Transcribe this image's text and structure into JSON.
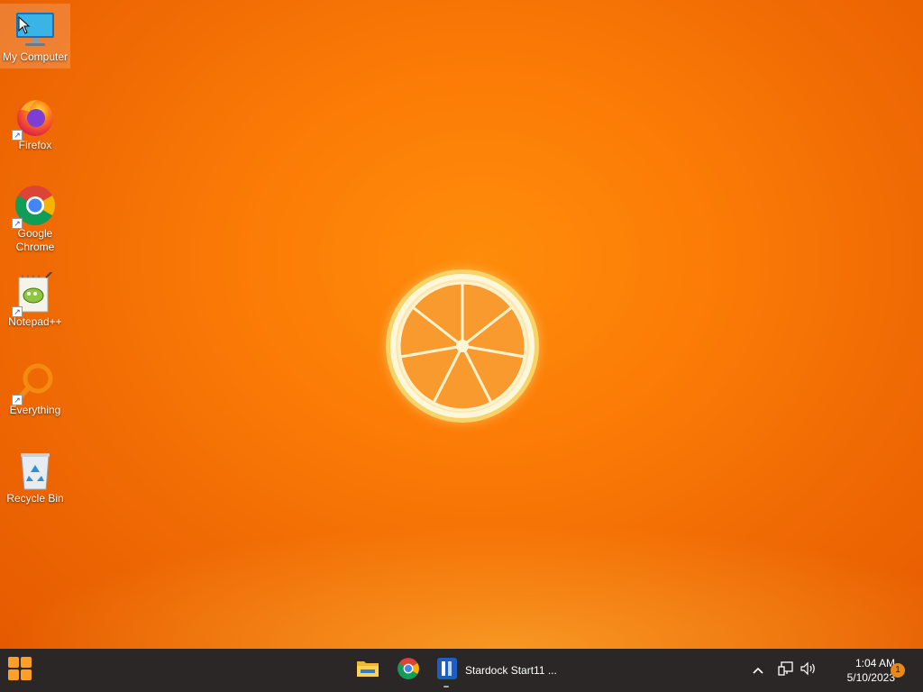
{
  "desktop": {
    "icons": [
      {
        "label": "My Computer",
        "icon": "monitor-icon",
        "shortcut": false,
        "selected": true
      },
      {
        "label": "Firefox",
        "icon": "firefox-icon",
        "shortcut": true,
        "selected": false
      },
      {
        "label": "Google Chrome",
        "icon": "chrome-icon",
        "shortcut": true,
        "selected": false
      },
      {
        "label": "Notepad++",
        "icon": "notepadpp-icon",
        "shortcut": true,
        "selected": false
      },
      {
        "label": "Everything",
        "icon": "everything-search-icon",
        "shortcut": true,
        "selected": false
      },
      {
        "label": "Recycle Bin",
        "icon": "recycle-bin-icon",
        "shortcut": false,
        "selected": false
      }
    ],
    "wallpaper": {
      "subject": "orange-slice",
      "accent": "#ff8c0a"
    }
  },
  "taskbar": {
    "start_icon": "start-menu-icon",
    "pinned": [
      {
        "icon": "file-explorer-icon"
      },
      {
        "icon": "chrome-icon"
      }
    ],
    "active_app": {
      "icon": "stardock-start11-icon",
      "label": "Stardock Start11 ..."
    },
    "tray": {
      "overflow_icon": "chevron-up-icon",
      "network_icon": "network-icon",
      "volume_icon": "volume-icon",
      "time": "1:04 AM",
      "date": "5/10/2023",
      "notification_count": "1"
    },
    "colors": {
      "background": "#2b2726",
      "badge": "#e8891a"
    }
  }
}
